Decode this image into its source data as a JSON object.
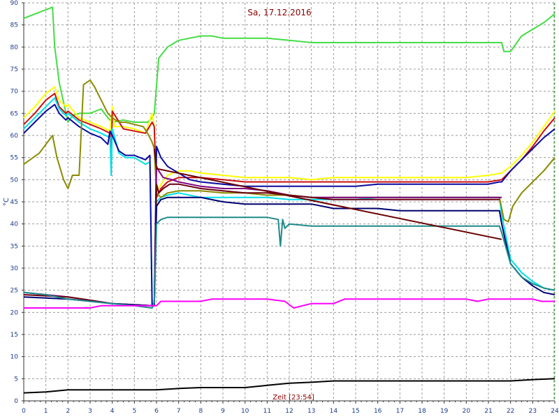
{
  "chart_data": {
    "type": "line",
    "title": "Sa, 17.12.2016",
    "ylabel": "°C",
    "cursor_label": "Zeit [23:54]",
    "xlim": [
      0,
      24
    ],
    "ylim": [
      0,
      90
    ],
    "x_ticks": [
      "0",
      "1",
      "2",
      "3",
      "4",
      "5",
      "6",
      "7",
      "8",
      "9",
      "10",
      "11",
      "12",
      "13",
      "14",
      "15",
      "16",
      "17",
      "18",
      "19",
      "20",
      "21",
      "22",
      "23",
      "24"
    ],
    "y_ticks": [
      "0",
      "5",
      "10",
      "15",
      "20",
      "25",
      "30",
      "35",
      "40",
      "45",
      "50",
      "55",
      "60",
      "65",
      "70",
      "75",
      "80",
      "85",
      "90"
    ],
    "grid": true,
    "series": [
      {
        "color": "#44dd44",
        "x": [
          0,
          1.3,
          1.4,
          1.6,
          2.0,
          2.2,
          2.5,
          3.0,
          3.5,
          3.8,
          4.0,
          4.5,
          5.0,
          5.6,
          5.8,
          5.9,
          6.1,
          6.5,
          7.0,
          7.5,
          8.0,
          8.5,
          9.0,
          10.0,
          11.0,
          12.0,
          13.0,
          14.0,
          15.0,
          16.0,
          17.0,
          18.0,
          19.0,
          20.0,
          21.0,
          21.6,
          21.7,
          22.0,
          22.5,
          23.0,
          23.5,
          24.0
        ],
        "y": [
          86.5,
          89.0,
          80.0,
          72.0,
          63.0,
          64.5,
          65.0,
          65.0,
          66.0,
          64.0,
          63.0,
          63.5,
          63.0,
          63.0,
          64.0,
          65.0,
          77.5,
          80.0,
          81.5,
          82.0,
          82.5,
          82.5,
          82.0,
          82.0,
          82.0,
          81.5,
          81.0,
          81.0,
          81.0,
          81.0,
          81.0,
          81.0,
          81.0,
          81.0,
          81.0,
          81.0,
          79.0,
          79.0,
          82.5,
          84.0,
          85.5,
          87.5
        ]
      },
      {
        "color": "#ffff00",
        "x": [
          0,
          0.5,
          1.0,
          1.4,
          1.6,
          1.9,
          2.0,
          2.5,
          3.0,
          3.5,
          3.9,
          4.0,
          4.1,
          4.5,
          5.0,
          5.5,
          5.8,
          5.9,
          6.0,
          6.2,
          6.5,
          7.0,
          7.5,
          8.0,
          9.0,
          10.0,
          11.0,
          12.0,
          13.0,
          14.0,
          15.0,
          16.0,
          17.0,
          18.0,
          19.0,
          20.0,
          21.0,
          21.6,
          22.0,
          22.5,
          23.0,
          23.5,
          24.0
        ],
        "y": [
          64.0,
          66.5,
          69.5,
          71.0,
          68.0,
          66.5,
          67.0,
          64.0,
          63.0,
          62.0,
          61.0,
          66.5,
          62.0,
          62.0,
          61.5,
          60.5,
          65.0,
          62.0,
          47.0,
          49.0,
          51.0,
          52.0,
          52.0,
          51.5,
          51.0,
          50.5,
          50.5,
          50.5,
          50.0,
          50.5,
          50.5,
          50.5,
          50.5,
          50.5,
          50.5,
          50.5,
          51.0,
          51.5,
          53.0,
          55.5,
          58.5,
          62.0,
          65.5
        ]
      },
      {
        "color": "#cc1010",
        "x": [
          0,
          0.5,
          1.0,
          1.4,
          1.6,
          1.9,
          2.0,
          2.5,
          3.0,
          3.5,
          3.9,
          3.95,
          4.0,
          4.5,
          5.0,
          5.5,
          5.8,
          5.9,
          6.0,
          6.2,
          6.5,
          7.0,
          7.5,
          8.0,
          9.0,
          10.0,
          11.0,
          12.0,
          13.0,
          14.0,
          15.0,
          16.0,
          17.0,
          18.0,
          19.0,
          20.0,
          21.0,
          21.6,
          22.0,
          22.5,
          23.0,
          23.5,
          24.0
        ],
        "y": [
          62.5,
          65.0,
          68.0,
          69.5,
          66.5,
          65.0,
          65.5,
          63.5,
          62.5,
          61.5,
          60.5,
          53.0,
          65.5,
          61.5,
          61.0,
          60.5,
          63.0,
          62.0,
          46.0,
          48.0,
          49.5,
          50.5,
          50.5,
          50.5,
          50.0,
          49.5,
          49.5,
          49.5,
          49.5,
          49.5,
          49.5,
          49.5,
          49.5,
          49.5,
          49.5,
          49.5,
          49.5,
          50.0,
          52.0,
          54.5,
          57.5,
          61.0,
          64.0
        ]
      },
      {
        "color": "#00e0e8",
        "x": [
          0,
          0.5,
          1.0,
          1.4,
          1.6,
          1.9,
          2.0,
          2.5,
          3.0,
          3.5,
          3.9,
          3.95,
          4.0,
          4.3,
          4.6,
          5.0,
          5.5,
          5.7,
          5.8,
          5.9,
          6.0,
          6.2,
          6.5,
          7.0,
          8.0,
          9.0,
          10.0,
          11.0,
          12.0,
          13.0,
          14.0,
          15.0,
          16.0,
          17.0,
          18.0,
          19.0,
          20.0,
          21.0,
          21.5,
          21.6,
          22.0,
          22.5,
          23.0,
          23.5,
          24.0
        ],
        "y": [
          61.5,
          64.0,
          66.5,
          68.5,
          66.0,
          64.5,
          65.0,
          63.0,
          61.5,
          60.5,
          59.5,
          51.0,
          61.5,
          56.0,
          55.0,
          55.0,
          53.5,
          54.0,
          22.0,
          22.0,
          45.0,
          46.0,
          46.5,
          47.0,
          46.0,
          46.0,
          46.0,
          46.0,
          45.5,
          45.5,
          45.5,
          45.5,
          46.0,
          46.0,
          46.0,
          46.0,
          46.0,
          46.0,
          46.0,
          42.0,
          32.0,
          29.0,
          27.0,
          25.5,
          25.0
        ]
      },
      {
        "color": "#0a0aa0",
        "x": [
          0,
          0.5,
          1.0,
          1.4,
          1.6,
          1.9,
          2.0,
          2.5,
          3.0,
          3.5,
          3.8,
          3.9,
          4.0,
          4.3,
          4.6,
          5.0,
          5.5,
          5.7,
          5.8,
          5.9,
          6.0,
          6.2,
          6.5,
          7.0,
          7.5,
          8.0,
          9.0,
          10.0,
          11.0,
          12.0,
          13.0,
          14.0,
          15.0,
          16.0,
          17.0,
          18.0,
          19.0,
          20.0,
          21.0,
          21.5,
          21.6,
          22.0,
          22.5,
          23.0,
          23.5,
          24.0
        ],
        "y": [
          60.5,
          63.0,
          65.5,
          67.0,
          65.0,
          63.5,
          64.0,
          62.0,
          60.5,
          59.5,
          58.0,
          61.0,
          60.0,
          56.5,
          55.5,
          55.5,
          54.5,
          55.5,
          21.5,
          21.5,
          57.5,
          55.0,
          53.0,
          51.5,
          50.0,
          49.5,
          49.0,
          48.5,
          48.5,
          48.5,
          48.5,
          48.5,
          48.5,
          49.0,
          49.0,
          49.0,
          49.0,
          49.0,
          49.0,
          49.5,
          49.5,
          52.0,
          54.5,
          57.0,
          59.5,
          61.5
        ]
      },
      {
        "color": "#8b8b00",
        "x": [
          0,
          0.7,
          1.0,
          1.3,
          1.5,
          1.8,
          2.0,
          2.2,
          2.5,
          2.7,
          3.0,
          3.2,
          3.5,
          3.8,
          4.0,
          4.3,
          4.6,
          5.0,
          5.4,
          5.6,
          5.8,
          5.9,
          6.0,
          6.2,
          6.5,
          7.0,
          7.5,
          8.0,
          9.0,
          10.0,
          11.0,
          12.0,
          13.0,
          14.0,
          15.0,
          16.0,
          17.0,
          18.0,
          19.0,
          20.0,
          21.0,
          21.5,
          21.7,
          21.9,
          22.1,
          22.5,
          23.0,
          23.5,
          24.0
        ],
        "y": [
          53.5,
          56.0,
          58.0,
          60.0,
          55.0,
          50.0,
          48.0,
          51.0,
          51.0,
          71.5,
          72.5,
          71.0,
          68.0,
          65.0,
          64.0,
          63.0,
          63.0,
          62.5,
          62.0,
          60.5,
          58.5,
          57.0,
          47.0,
          46.0,
          47.0,
          47.5,
          47.5,
          47.5,
          47.0,
          47.0,
          46.5,
          46.5,
          46.0,
          46.0,
          46.0,
          46.0,
          46.0,
          46.0,
          46.0,
          46.0,
          46.0,
          46.0,
          41.0,
          40.5,
          44.0,
          47.0,
          49.5,
          52.0,
          55.0
        ]
      },
      {
        "color": "#800080",
        "x": [
          0,
          2.0,
          4.0,
          5.8,
          5.9,
          6.0,
          6.1,
          6.3,
          6.7,
          7.0,
          7.5,
          8.0,
          9.0,
          10.0,
          11.0,
          12.0,
          13.0,
          14.0,
          15.0,
          16.0,
          17.0,
          18.0,
          19.0,
          20.0,
          21.0,
          21.5,
          21.6
        ],
        "y": [
          24.5,
          23.5,
          22.0,
          21.5,
          21.5,
          53.0,
          52.0,
          50.5,
          50.0,
          49.5,
          49.0,
          48.5,
          48.0,
          48.0,
          47.5,
          46.5,
          46.0,
          46.0,
          46.0,
          46.0,
          46.0,
          46.0,
          46.0,
          46.0,
          46.0,
          46.0,
          46.0
        ]
      },
      {
        "color": "#6a0010",
        "x": [
          0,
          2.0,
          4.0,
          5.8,
          5.9,
          6.0,
          6.1,
          6.3,
          6.6,
          7.0,
          7.5,
          8.0,
          9.0,
          10.0,
          11.0,
          12.0,
          13.0,
          14.0,
          15.0,
          16.0,
          17.0,
          18.0,
          19.0,
          20.0,
          21.0,
          21.5
        ],
        "y": [
          24.0,
          23.5,
          22.0,
          21.5,
          21.5,
          49.0,
          47.0,
          48.0,
          49.0,
          49.0,
          48.5,
          48.0,
          47.5,
          47.0,
          47.0,
          46.5,
          46.0,
          45.5,
          45.5,
          45.5,
          45.5,
          45.5,
          45.5,
          45.5,
          45.5,
          45.5
        ]
      },
      {
        "color": "#000070",
        "x": [
          0,
          2.0,
          4.0,
          5.8,
          5.9,
          6.0,
          6.2,
          6.5,
          7.0,
          8.0,
          9.0,
          10.0,
          11.0,
          12.0,
          13.0,
          14.0,
          15.0,
          16.0,
          17.0,
          18.0,
          19.0,
          20.0,
          21.0,
          21.5,
          21.6,
          22.0,
          22.5,
          23.0,
          23.5,
          24.0
        ],
        "y": [
          23.5,
          23.0,
          22.0,
          21.5,
          21.5,
          44.0,
          45.5,
          46.0,
          46.0,
          46.0,
          45.0,
          44.5,
          44.5,
          44.5,
          44.5,
          43.5,
          43.5,
          43.5,
          43.0,
          43.0,
          43.0,
          43.0,
          43.0,
          43.0,
          40.0,
          31.0,
          28.0,
          26.0,
          24.5,
          24.0
        ]
      },
      {
        "color": "#1e8a8a",
        "x": [
          0,
          1.0,
          2.0,
          3.0,
          4.0,
          5.0,
          5.8,
          5.9,
          6.0,
          6.2,
          6.5,
          7.0,
          8.0,
          9.0,
          10.0,
          11.0,
          11.5,
          11.6,
          11.7,
          11.8,
          12.0,
          13.0,
          14.0,
          15.0,
          16.0,
          17.0,
          18.0,
          19.0,
          20.0,
          21.0,
          21.5,
          21.6,
          22.0,
          22.5,
          23.0,
          23.5,
          24.0
        ],
        "y": [
          24.5,
          24.0,
          23.0,
          22.5,
          22.0,
          21.5,
          21.0,
          22.0,
          40.0,
          41.0,
          41.5,
          41.5,
          41.5,
          41.5,
          41.5,
          41.5,
          41.0,
          35.0,
          41.0,
          39.0,
          40.0,
          39.5,
          39.5,
          39.5,
          39.5,
          39.5,
          39.5,
          39.5,
          39.5,
          39.5,
          39.5,
          38.0,
          31.0,
          28.0,
          26.5,
          25.5,
          25.0
        ]
      },
      {
        "color": "#ff00ff",
        "x": [
          0,
          3.0,
          3.5,
          5.5,
          6.0,
          6.2,
          7.0,
          8.0,
          8.5,
          9.0,
          10.0,
          11.0,
          11.8,
          12.2,
          13.0,
          14.0,
          14.5,
          15.0,
          16.0,
          17.0,
          18.0,
          19.0,
          20.0,
          20.5,
          21.0,
          22.0,
          23.0,
          23.4,
          24.0
        ],
        "y": [
          21.0,
          21.0,
          21.5,
          21.5,
          21.5,
          22.5,
          22.5,
          22.5,
          23.0,
          23.0,
          23.0,
          23.0,
          22.5,
          21.0,
          22.0,
          22.0,
          23.0,
          23.0,
          23.0,
          23.0,
          23.0,
          23.0,
          23.0,
          22.5,
          23.0,
          23.0,
          23.0,
          22.5,
          22.5
        ]
      },
      {
        "color": "#000000",
        "x": [
          0,
          1.0,
          2.0,
          3.0,
          4.0,
          5.0,
          6.0,
          7.0,
          8.0,
          9.0,
          10.0,
          11.0,
          12.0,
          13.0,
          14.0,
          15.0,
          16.0,
          17.0,
          18.0,
          19.0,
          20.0,
          21.0,
          22.0,
          23.0,
          24.0
        ],
        "y": [
          1.8,
          2.0,
          2.5,
          2.5,
          2.5,
          2.5,
          2.5,
          2.8,
          3.0,
          3.0,
          3.0,
          3.5,
          4.0,
          4.2,
          4.5,
          4.5,
          4.5,
          4.5,
          4.5,
          4.5,
          4.5,
          4.5,
          4.5,
          4.8,
          5.0
        ]
      },
      {
        "color": "#6b0000",
        "x": [
          5.9,
          6.0,
          21.6
        ],
        "y": [
          57.0,
          52.5,
          36.5
        ]
      }
    ]
  }
}
